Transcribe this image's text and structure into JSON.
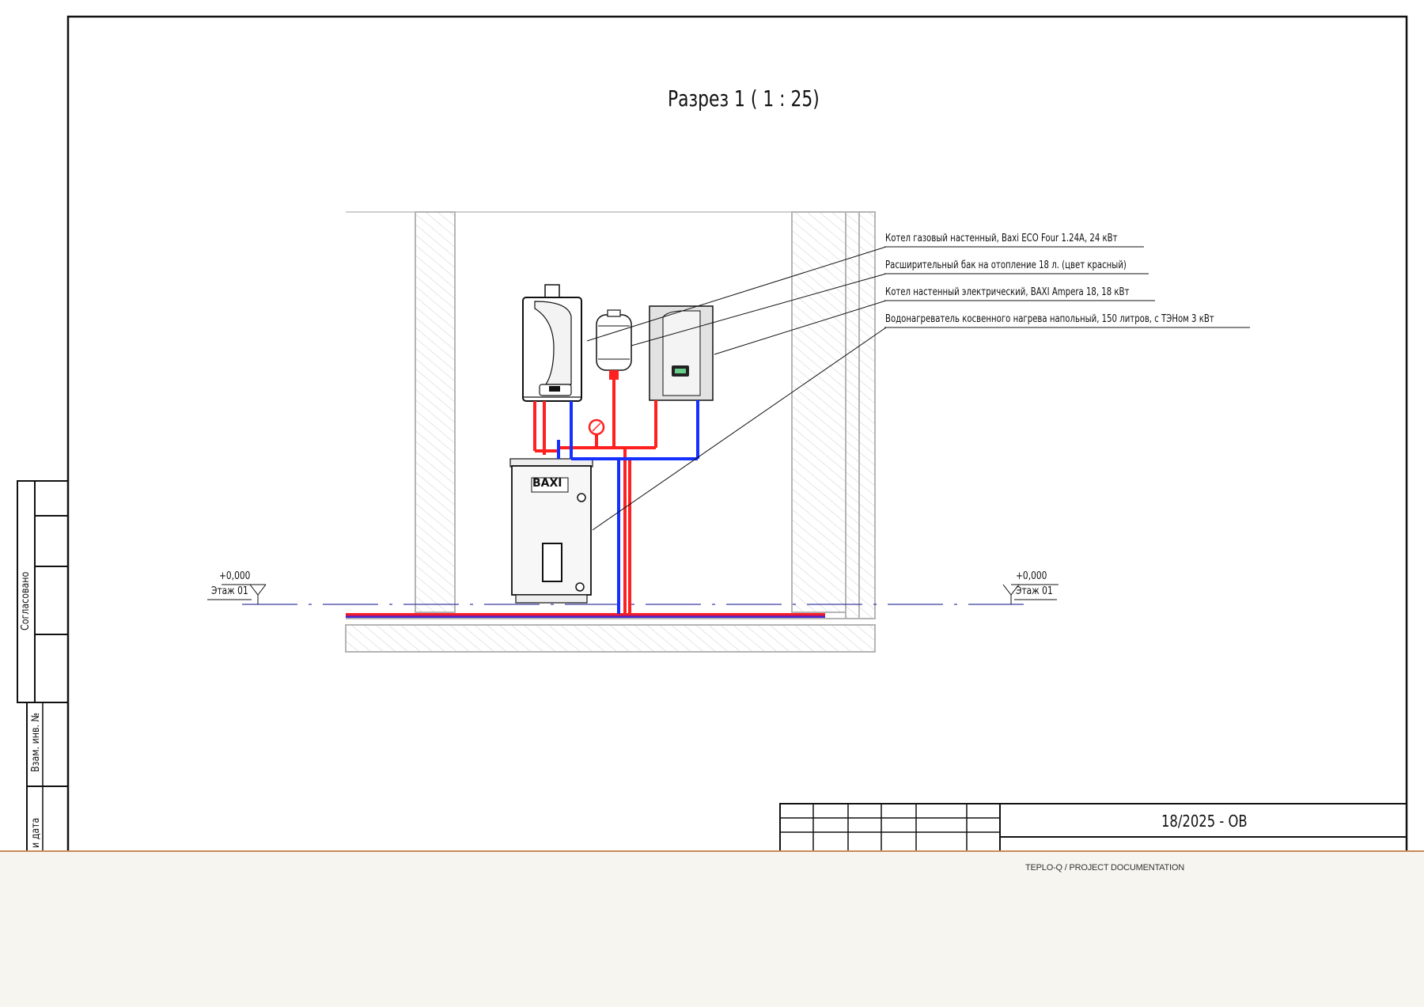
{
  "drawing": {
    "title": "Разрез 1 ( 1 : 25)",
    "callouts": [
      "Котел газовый настенный, Baxi ECO Four 1.24A, 24 кВт",
      "Расширительный бак на отопление 18 л. (цвет красный)",
      "Котел настенный электрический, BAXI Ampera 18, 18 кВт",
      "Водонагреватель косвенного нагрева напольный, 150 литров, с ТЭНом 3 кВт"
    ],
    "level_left": {
      "mark": "+0,000",
      "name": "Этаж 01"
    },
    "level_right": {
      "mark": "+0,000",
      "name": "Этаж 01"
    },
    "heater_brand": "BAXI"
  },
  "stamp": {
    "agreed": "Согласовано",
    "inv_no": "Взам. инв. №",
    "date": "и дата",
    "doc_code": "18/2025 - ОВ"
  },
  "footer": {
    "text": "TEPLO-Q / PROJECT DOCUMENTATION"
  },
  "colors": {
    "supply": "#ff2020",
    "return": "#1530ff",
    "accent": "#c98a5a",
    "wall": "#bdbdbd"
  }
}
